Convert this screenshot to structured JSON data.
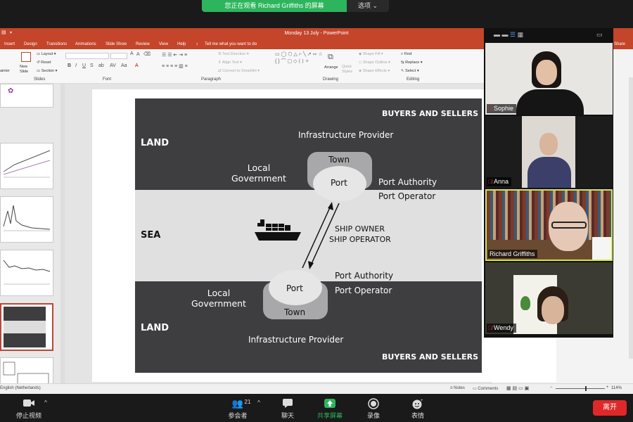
{
  "zoom": {
    "share_banner": "您正在观看 Richard Griffiths 的屏幕",
    "options_label": "选项",
    "stop_video_label": "停止视频",
    "participants_label": "参会者",
    "participants_count": "21",
    "chat_label": "聊天",
    "share_label": "共享屏幕",
    "record_label": "录像",
    "reactions_label": "表情",
    "leave_label": "离开"
  },
  "ppt": {
    "title": "Monday 13 July  -  PowerPoint",
    "share_label": "Share",
    "tabs": [
      "Insert",
      "Design",
      "Transitions",
      "Animations",
      "Slide Show",
      "Review",
      "View",
      "Help"
    ],
    "tell_me": "Tell me what you want to do",
    "ribbon": {
      "slides_group": "Slides",
      "font_group": "Font",
      "paragraph_group": "Paragraph",
      "drawing_group": "Drawing",
      "editing_group": "Editing",
      "new_slide": "New Slide",
      "layout": "Layout",
      "reset": "Reset",
      "section": "Section",
      "painter": "ainter",
      "text_direction": "Text Direction",
      "align_text": "Align Text",
      "convert_smartart": "Convert to SmartArt",
      "arrange": "Arrange",
      "quick_styles": "Quick Styles",
      "shape_fill": "Shape Fill",
      "shape_outline": "Shape Outline",
      "shape_effects": "Shape Effects",
      "find": "Find",
      "replace": "Replace",
      "select": "Select"
    },
    "status": {
      "language": "English (Netherlands)",
      "notes": "Notes",
      "comments": "Comments",
      "zoom": "114%"
    }
  },
  "slide": {
    "buyers_sellers_top": "BUYERS AND SELLERS",
    "infra_top": "Infrastructure Provider",
    "land_top": "LAND",
    "local_gov_top": "Local\nGovernment",
    "town_top": "Town",
    "port_top": "Port",
    "port_authority_top": "Port Authority",
    "port_operator_top": "Port Operator",
    "sea": "SEA",
    "ship_owner": "SHIP OWNER",
    "ship_operator": "SHIP OPERATOR",
    "port_authority_bottom": "Port Authority",
    "port_operator_bottom": "Port Operator",
    "port_bottom": "Port",
    "town_bottom": "Town",
    "local_gov_bottom": "Local\nGovernment",
    "land_bottom": "LAND",
    "infra_bottom": "Infrastructure Provider",
    "buyers_sellers_bottom": "BUYERS AND SELLERS"
  },
  "participants": [
    {
      "name": "Sophie"
    },
    {
      "name": "Anna"
    },
    {
      "name": "Richard Griffiths"
    },
    {
      "name": "Wendy"
    }
  ]
}
